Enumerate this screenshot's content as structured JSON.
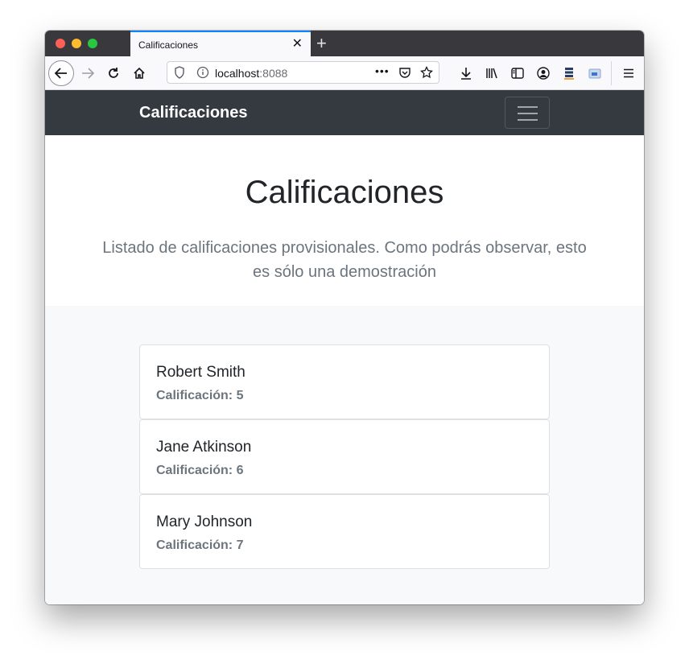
{
  "browser": {
    "tab_title": "Calificaciones",
    "tab_close_icon": "close-icon",
    "new_tab_symbol": "+",
    "url_host": "localhost",
    "url_port": ":8088",
    "page_actions": "•••",
    "accent_color": "#0a84ff"
  },
  "site": {
    "brand": "Calificaciones",
    "navbar_color": "#343a40"
  },
  "jumbotron": {
    "title": "Calificaciones",
    "lead": "Listado de calificaciones provisionales. Como podrás observar, esto es sólo una demostración"
  },
  "students": [
    {
      "name": "Robert Smith",
      "grade_label": "Calificación: 5"
    },
    {
      "name": "Jane Atkinson",
      "grade_label": "Calificación: 6"
    },
    {
      "name": "Mary Johnson",
      "grade_label": "Calificación: 7"
    }
  ]
}
